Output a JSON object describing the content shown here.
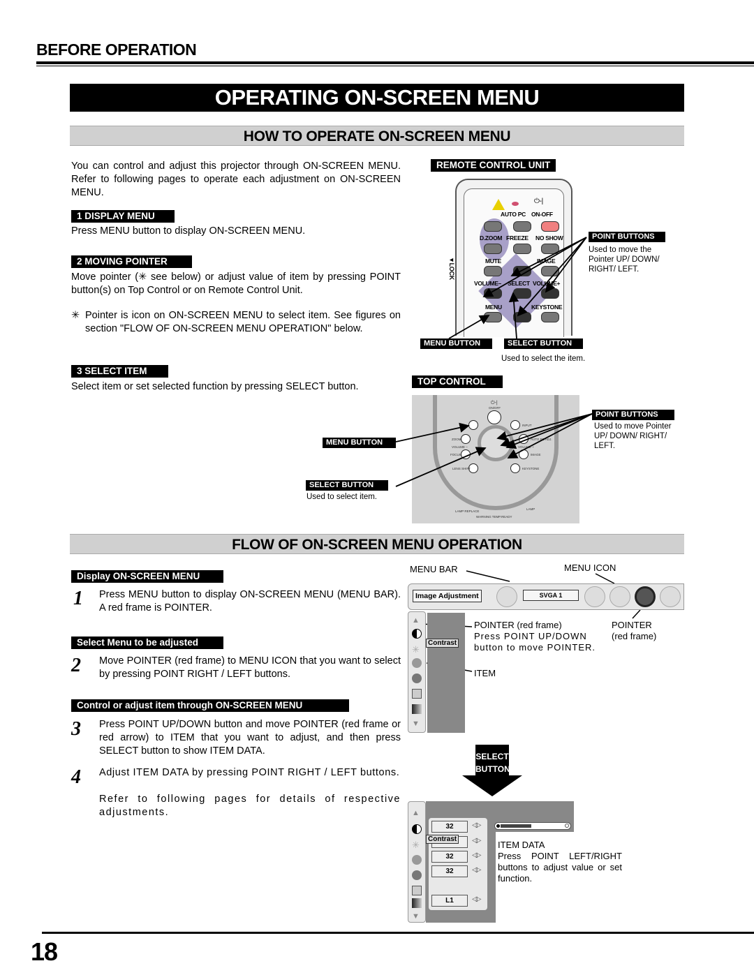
{
  "header": {
    "section": "BEFORE OPERATION",
    "title": "OPERATING ON-SCREEN MENU",
    "subtitle": "HOW TO OPERATE ON-SCREEN MENU"
  },
  "intro": "You can control and adjust this projector through ON-SCREEN MENU.  Refer to following pages to operate each adjustment on ON-SCREEN MENU.",
  "steps_how": [
    {
      "tag": "1  DISPLAY MENU",
      "text": "Press MENU button to display ON-SCREEN MENU."
    },
    {
      "tag": "2  MOVING POINTER",
      "text": "Move pointer (✳ see below) or adjust value of item by pressing POINT button(s) on Top Control or on Remote Control Unit."
    },
    {
      "tag": "3  SELECT ITEM",
      "text": "Select item or set selected function by pressing SELECT button."
    }
  ],
  "pointer_note": {
    "mark": "✳",
    "text": "Pointer is icon on ON-SCREEN MENU to select item.  See figures on section \"FLOW OF ON-SCREEN MENU OPERATION\" below."
  },
  "remote": {
    "title": "REMOTE CONTROL UNIT",
    "power_symbol": "⏻-|",
    "labels": {
      "auto_pc": "AUTO PC",
      "on_off": "ON-OFF",
      "dzoom": "D.ZOOM",
      "freeze": "FREEZE",
      "no_show": "NO SHOW",
      "mute": "MUTE",
      "image": "IMAGE",
      "volume_minus": "VOLUME–",
      "select": "SELECT",
      "volume_plus": "VOLUME+",
      "menu": "MENU",
      "keystone": "KEYSTONE",
      "lock": "▼LOCK"
    },
    "point_buttons_tag": "POINT BUTTONS",
    "point_buttons_desc": "Used to move the Pointer UP/ DOWN/ RIGHT/ LEFT.",
    "menu_button_tag": "MENU BUTTON",
    "select_button_tag": "SELECT BUTTON",
    "select_button_desc": "Used to select the item."
  },
  "top_control": {
    "title": "TOP CONTROL",
    "labels": {
      "power": "⏻-|",
      "on_off": "ON/OFF",
      "input": "INPUT",
      "zoom": "ZOOM",
      "auto_pc_adj": "AUTO PC ADJ.",
      "volume_minus": "VOLUME –",
      "volume_plus": "VOLUME +",
      "select": "SELECT",
      "focus": "FOCUS",
      "image": "IMAGE",
      "lens_shift": "LENS SHIFT",
      "keystone": "KEYSTONE",
      "lamp_replace": "LAMP REPLACE",
      "warning_temp": "WARNING TEMP.",
      "ready": "READY",
      "lamp": "LAMP"
    },
    "point_buttons_tag": "POINT BUTTONS",
    "point_buttons_desc": "Used to move Pointer UP/ DOWN/ RIGHT/ LEFT.",
    "menu_button_tag": "MENU BUTTON",
    "select_button_tag": "SELECT BUTTON",
    "select_button_desc": "Used to select item."
  },
  "flow": {
    "title": "FLOW OF ON-SCREEN MENU OPERATION",
    "groups": [
      {
        "tag": "Display ON-SCREEN MENU",
        "steps": [
          {
            "num": "1",
            "text": "Press MENU button to display ON-SCREEN MENU (MENU BAR).  A red frame is POINTER."
          }
        ]
      },
      {
        "tag": "Select Menu to be adjusted",
        "steps": [
          {
            "num": "2",
            "text": "Move POINTER (red frame) to MENU ICON that you want to select by pressing POINT RIGHT / LEFT buttons."
          }
        ]
      },
      {
        "tag": "Control or adjust item through ON-SCREEN MENU",
        "steps": [
          {
            "num": "3",
            "text": "Press POINT UP/DOWN button and move POINTER (red frame or red arrow) to ITEM that you want to adjust, and then press SELECT button to show ITEM DATA."
          },
          {
            "num": "4",
            "text": "Adjust ITEM DATA by pressing POINT RIGHT / LEFT buttons.",
            "text2": "Refer to following pages for details of respective adjustments."
          }
        ]
      }
    ],
    "osd": {
      "menu_bar_label": "MENU BAR",
      "menu_icon_label": "MENU ICON",
      "menu_name": "Image Adjustment",
      "source": "SVGA 1",
      "pointer_label": "POINTER (red frame)",
      "pointer_desc": "Press POINT UP/DOWN button to move POINTER.",
      "pointer_right_1": "POINTER",
      "pointer_right_2": "(red frame)",
      "item_label": "ITEM",
      "tooltip": "Contrast",
      "select_arrow_1": "SELECT",
      "select_arrow_2": "BUTTON",
      "item_values": [
        "32",
        "",
        "32",
        "32",
        "L1"
      ],
      "arrows_glyph": "◁▷",
      "slider_fraction": 0.5,
      "item_data_label": "ITEM DATA",
      "item_data_desc": "Press POINT LEFT/RIGHT buttons to adjust value or set function."
    }
  },
  "page_number": "18"
}
